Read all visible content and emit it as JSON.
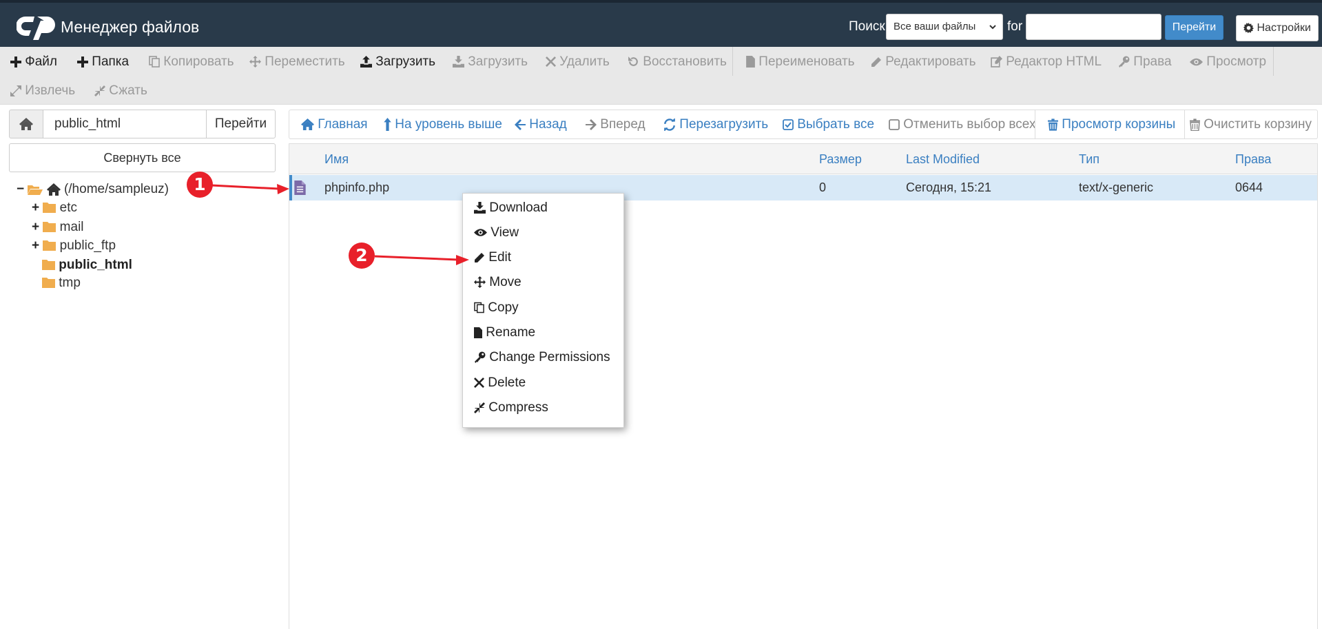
{
  "header": {
    "app_title": "Менеджер файлов",
    "search_label": "Поиск",
    "search_scope": "Все ваши файлы",
    "for_label": "for",
    "search_value": "",
    "go_label": "Перейти",
    "settings_label": "Настройки"
  },
  "toolbar": {
    "items": [
      {
        "label": "Файл",
        "icon": "plus-icon",
        "enabled": true
      },
      {
        "label": "Папка",
        "icon": "plus-icon",
        "enabled": true
      },
      {
        "label": "Копировать",
        "icon": "copy-icon",
        "enabled": false
      },
      {
        "label": "Переместить",
        "icon": "move-icon",
        "enabled": false
      },
      {
        "label": "Загрузить",
        "icon": "upload-icon",
        "enabled": true
      },
      {
        "label": "Загрузить",
        "icon": "download-icon",
        "enabled": false
      },
      {
        "label": "Удалить",
        "icon": "close-icon",
        "enabled": false
      },
      {
        "label": "Восстановить",
        "icon": "undo-icon",
        "enabled": false
      },
      {
        "label": "Переименовать",
        "icon": "file-icon",
        "enabled": false
      },
      {
        "label": "Редактировать",
        "icon": "pencil-icon",
        "enabled": false
      },
      {
        "label": "Редактор HTML",
        "icon": "edit-square-icon",
        "enabled": false
      },
      {
        "label": "Права",
        "icon": "key-icon",
        "enabled": false
      },
      {
        "label": "Просмотр",
        "icon": "eye-icon",
        "enabled": false
      },
      {
        "label": "Извлечь",
        "icon": "expand-icon",
        "enabled": false
      },
      {
        "label": "Сжать",
        "icon": "compress-icon",
        "enabled": false
      }
    ]
  },
  "sidebar": {
    "path_value": "public_html",
    "path_go_label": "Перейти",
    "collapse_label": "Свернуть все",
    "tree": [
      {
        "label": "(/home/sampleuz)",
        "expander": "−",
        "open": true,
        "home": true
      },
      {
        "label": "etc",
        "expander": "+"
      },
      {
        "label": "mail",
        "expander": "+"
      },
      {
        "label": "public_ftp",
        "expander": "+"
      },
      {
        "label": "public_html",
        "expander": "",
        "current": true
      },
      {
        "label": "tmp",
        "expander": ""
      }
    ]
  },
  "nav": {
    "items": [
      {
        "label": "Главная",
        "icon": "home-icon",
        "enabled": true
      },
      {
        "label": "На уровень выше",
        "icon": "level-up-icon",
        "enabled": true
      },
      {
        "label": "Назад",
        "icon": "arrow-left-icon",
        "enabled": true
      },
      {
        "label": "Вперед",
        "icon": "arrow-right-icon",
        "enabled": false
      },
      {
        "label": "Перезагрузить",
        "icon": "refresh-icon",
        "enabled": true
      },
      {
        "label": "Выбрать все",
        "icon": "checkbox-checked-icon",
        "enabled": true
      },
      {
        "label": "Отменить выбор всех",
        "icon": "checkbox-empty-icon",
        "enabled": false
      },
      {
        "label": "Просмотр корзины",
        "icon": "trash-icon",
        "enabled": true
      },
      {
        "label": "Очистить корзину",
        "icon": "trash-icon",
        "enabled": false
      }
    ]
  },
  "table": {
    "columns": [
      "Имя",
      "Размер",
      "Last Modified",
      "Тип",
      "Права"
    ],
    "rows": [
      {
        "name": "phpinfo.php",
        "size": "0",
        "modified": "Сегодня, 15:21",
        "type": "text/x-generic",
        "perms": "0644",
        "selected": true
      }
    ]
  },
  "context_menu": {
    "items": [
      {
        "label": "Download",
        "icon": "download-icon"
      },
      {
        "label": "View",
        "icon": "eye-icon"
      },
      {
        "label": "Edit",
        "icon": "pencil-icon"
      },
      {
        "label": "Move",
        "icon": "move-icon"
      },
      {
        "label": "Copy",
        "icon": "copy-icon"
      },
      {
        "label": "Rename",
        "icon": "file-icon"
      },
      {
        "label": "Change Permissions",
        "icon": "key-icon"
      },
      {
        "label": "Delete",
        "icon": "close-icon"
      },
      {
        "label": "Compress",
        "icon": "compress-icon"
      }
    ]
  },
  "annotations": {
    "step1": "1",
    "step2": "2",
    "color": "#e8202a"
  },
  "colors": {
    "header_bg": "#293a4a",
    "link_blue": "#3a7fc1",
    "primary_button": "#428bca",
    "folder": "#f0ad4e",
    "file_icon": "#7b6aa8"
  }
}
